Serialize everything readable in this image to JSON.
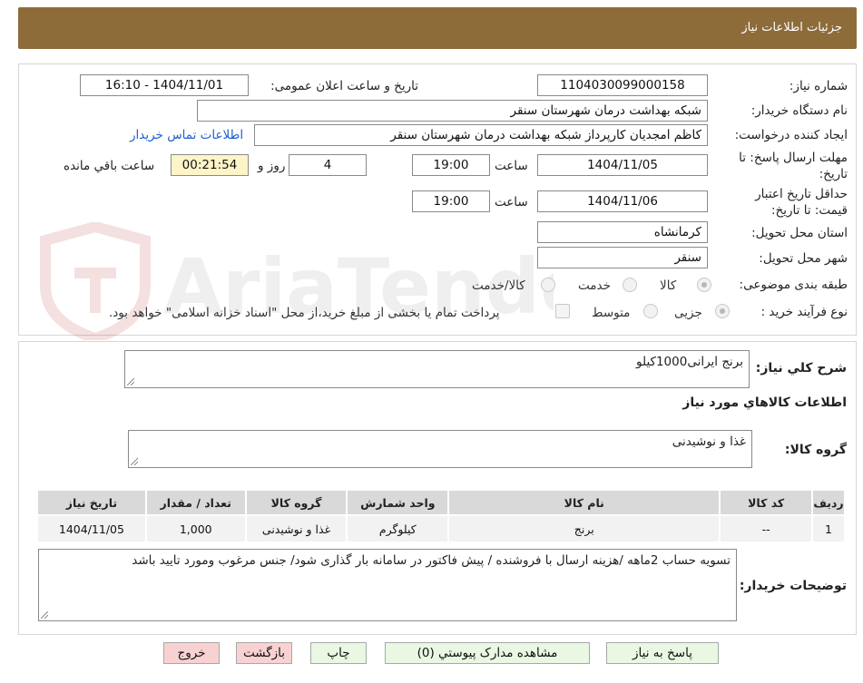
{
  "header": {
    "title": "جزئیات اطلاعات نیاز"
  },
  "form": {
    "need_number_label": "شماره نیاز:",
    "need_number": "1104030099000158",
    "announce_label": "تاریخ و ساعت اعلان عمومی:",
    "announce_value": "1404/11/01 - 16:10",
    "buyer_org_label": "نام دستگاه خریدار:",
    "buyer_org": "شبکه بهداشت درمان شهرستان سنقر",
    "creator_label": "ایجاد کننده درخواست:",
    "creator": "کاظم امجدیان کارپرداز شبکه بهداشت درمان شهرستان سنقر",
    "contact_link": "اطلاعات تماس خریدار",
    "deadline_label_1": "مهلت ارسال پاسخ: تا",
    "deadline_label_2": "تاریخ:",
    "deadline_date": "1404/11/05",
    "time_label": "ساعت",
    "deadline_time": "19:00",
    "days_value": "4",
    "days_label": "روز و",
    "remaining_time": "00:21:54",
    "remaining_label": "ساعت باقي مانده",
    "validity_label_1": "حداقل تاریخ اعتبار",
    "validity_label_2": "قیمت: تا تاریخ:",
    "validity_date": "1404/11/06",
    "validity_time": "19:00",
    "province_label": "استان محل تحویل:",
    "province": "کرمانشاه",
    "city_label": "شهر محل تحویل:",
    "city": "سنقر",
    "category_label": "طبقه بندی موضوعی:",
    "category_options": [
      "کالا",
      "خدمت",
      "کالا/خدمت"
    ],
    "process_label": "نوع فرآیند خرید :",
    "process_options": [
      "جزیی",
      "متوسط"
    ],
    "process_note": "پرداخت تمام یا بخشی از مبلغ خرید،از محل \"اسناد خزانه اسلامی\" خواهد بود."
  },
  "details": {
    "summary_label": "شرح كلي نياز:",
    "summary": "برنج ایرانی1000کیلو",
    "goods_info_title": "اطلاعات كالاهاي مورد نياز",
    "goods_group_label": "گروه کالا:",
    "goods_group": "غذا و نوشیدنی",
    "buyer_notes_label": "توضیحات خریدار:",
    "buyer_notes": "تسویه حساب 2ماهه /هزینه ارسال با فروشنده / پیش فاکتور در سامانه بار گذاری شود/ جنس مرغوب ومورد تایید باشد"
  },
  "table": {
    "headers": [
      "رديف",
      "کد کالا",
      "نام کالا",
      "واحد شمارش",
      "گروه کالا",
      "تعداد / مقدار",
      "تاریخ نیاز"
    ],
    "rows": [
      [
        "1",
        "--",
        "برنج",
        "کیلوگرم",
        "غذا و نوشیدنی",
        "1,000",
        "1404/11/05"
      ]
    ]
  },
  "buttons": {
    "reply": "پاسخ به نیاز",
    "attachments": "مشاهده مدارک پیوستي (0)",
    "print": "چاپ",
    "back": "بازگشت",
    "exit": "خروج"
  },
  "colors": {
    "header_bg": "#8e6c3a",
    "link": "#1a5fd0",
    "timer_bg": "#fdf5c8",
    "green_btn": "#e9f7e3",
    "pink_btn": "#f8d2d2"
  },
  "watermark": {
    "text": "AriaTender.net"
  }
}
